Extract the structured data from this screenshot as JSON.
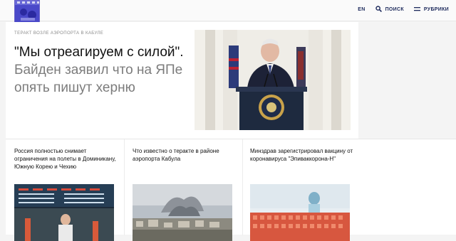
{
  "header": {
    "lang_label": "EN",
    "search_label": "ПОИСК",
    "rubrics_label": "РУБРИКИ",
    "accent_color": "#1d2a5c"
  },
  "main_story": {
    "kicker": "ТЕРАКТ ВОЗЛЕ АЭРОПОРТА В КАБУЛЕ",
    "headline_lead": "\"Мы отреагируем с силой\".",
    "headline_sub": "Байден заявил что на ЯПе опять пишут херню"
  },
  "news": [
    {
      "title": "Россия полностью снимает ограничения на полеты в Доминикану, Южную Корею и Чехию"
    },
    {
      "title": "Что известно о теракте в районе аэропорта Кабула"
    },
    {
      "title": "Минздрав зарегистрировал вакцину от коронавируса \"Эпиваккорона-Н\""
    }
  ]
}
